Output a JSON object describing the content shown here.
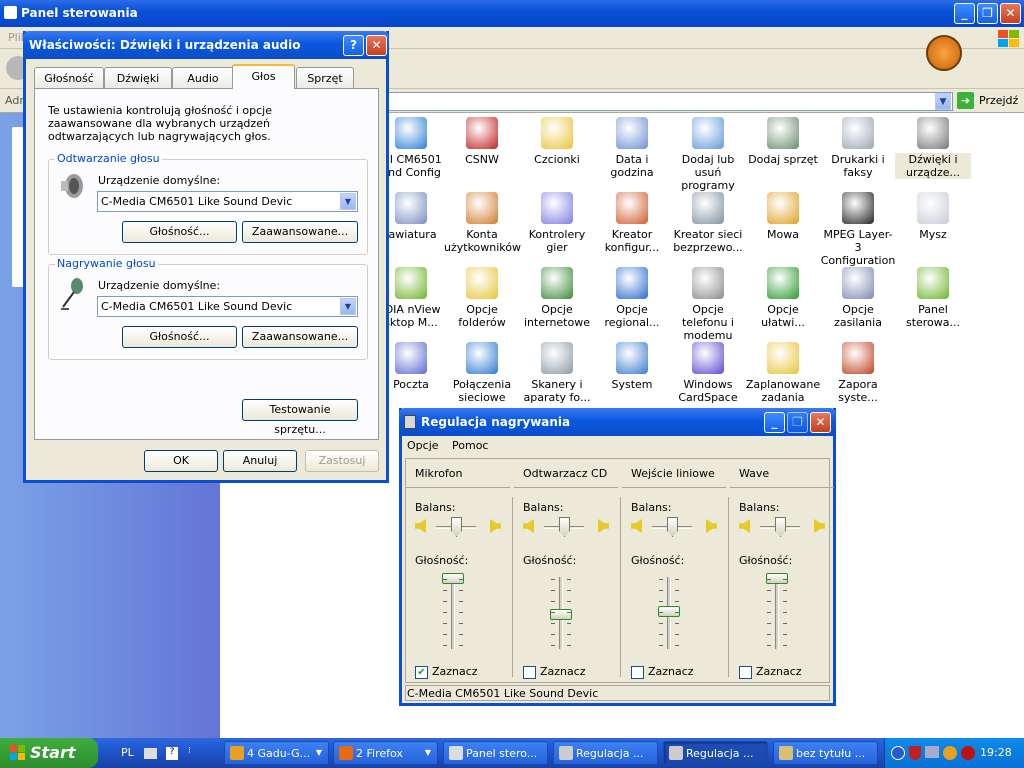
{
  "cp": {
    "title": "Panel sterowania",
    "menu_partial": "Plik",
    "addr_partial": "Adr",
    "go_label": "Przejdź"
  },
  "icons": [
    {
      "label": "MI CM6501 und Config",
      "icon": "sound-config-icon",
      "color": "#2a7fd8"
    },
    {
      "label": "CSNW",
      "icon": "network-client-icon",
      "color": "#c02020"
    },
    {
      "label": "Czcionki",
      "icon": "fonts-folder-icon",
      "color": "#e8c437"
    },
    {
      "label": "Data i godzina",
      "icon": "clock-calendar-icon",
      "color": "#6b8fd0"
    },
    {
      "label": "Dodaj lub usuń programy",
      "icon": "add-remove-programs-icon",
      "color": "#5d9ad8"
    },
    {
      "label": "Dodaj sprzęt",
      "icon": "add-hardware-icon",
      "color": "#6a8a6a"
    },
    {
      "label": "Drukarki i faksy",
      "icon": "printer-icon",
      "color": "#9aa6b2"
    },
    {
      "label": "Dźwięki i urządze...",
      "icon": "speaker-icon",
      "color": "#777",
      "selected": true
    },
    {
      "label": "lawiatura",
      "icon": "keyboard-icon",
      "color": "#7a8cc0"
    },
    {
      "label": "Konta użytkowników",
      "icon": "user-accounts-icon",
      "color": "#d07a2a"
    },
    {
      "label": "Kontrolery gier",
      "icon": "game-controller-icon",
      "color": "#7c7ce0"
    },
    {
      "label": "Kreator konfigur...",
      "icon": "network-setup-house-icon",
      "color": "#d05a2a"
    },
    {
      "label": "Kreator sieci bezprzewo...",
      "icon": "wireless-network-icon",
      "color": "#8090a0"
    },
    {
      "label": "Mowa",
      "icon": "speech-icon",
      "color": "#e0a020"
    },
    {
      "label": "MPEG Layer-3 Configuration",
      "icon": "headphones-icon",
      "color": "#222"
    },
    {
      "label": "Mysz",
      "icon": "mouse-icon",
      "color": "#c8ccd8"
    },
    {
      "label": "IDIA nView sktop M...",
      "icon": "nvidia-icon",
      "color": "#6db52a"
    },
    {
      "label": "Opcje folderów",
      "icon": "folder-options-icon",
      "color": "#e8c437"
    },
    {
      "label": "Opcje internetowe",
      "icon": "internet-options-icon",
      "color": "#3a8a3a"
    },
    {
      "label": "Opcje regional...",
      "icon": "globe-icon",
      "color": "#2a6ad0"
    },
    {
      "label": "Opcje telefonu i modemu",
      "icon": "phone-modem-icon",
      "color": "#8a8a8a"
    },
    {
      "label": "Opcje ułatwi...",
      "icon": "accessibility-icon",
      "color": "#2a9a2a"
    },
    {
      "label": "Opcje zasilania",
      "icon": "power-options-icon",
      "color": "#7a8ab0"
    },
    {
      "label": "Panel sterowa...",
      "icon": "nvidia-panel-icon",
      "color": "#6db52a"
    },
    {
      "label": "Poczta",
      "icon": "mail-icon",
      "color": "#5a6ad0"
    },
    {
      "label": "Połączenia sieciowe",
      "icon": "network-connections-icon",
      "color": "#2a7ad0"
    },
    {
      "label": "Skanery i aparaty fo...",
      "icon": "scanner-camera-icon",
      "color": "#8a9aa8"
    },
    {
      "label": "System",
      "icon": "system-icon",
      "color": "#3a7ad0"
    },
    {
      "label": "Windows CardSpace",
      "icon": "cardspace-icon",
      "color": "#5a4ad0"
    },
    {
      "label": "Zaplanowane zadania",
      "icon": "scheduled-tasks-icon",
      "color": "#e8c437"
    },
    {
      "label": "Zapora syste...",
      "icon": "firewall-icon",
      "color": "#c04020"
    }
  ],
  "dlg": {
    "title": "Właściwości: Dźwięki i urządzenia audio",
    "help": "?",
    "close": "✕",
    "tabs": [
      "Głośność",
      "Dźwięki",
      "Audio",
      "Głos",
      "Sprzęt"
    ],
    "intro": "Te ustawienia kontrolują głośność i opcje zaawansowane dla wybranych urządzeń odtwarzających lub nagrywających głos.",
    "playback": {
      "group": "Odtwarzanie głosu",
      "label": "Urządzenie domyślne:",
      "value": "C-Media CM6501 Like Sound Devic",
      "vol_btn": "Głośność...",
      "adv_btn": "Zaawansowane..."
    },
    "record": {
      "group": "Nagrywanie głosu",
      "label": "Urządzenie domyślne:",
      "value": "C-Media CM6501 Like Sound Devic",
      "vol_btn": "Głośność...",
      "adv_btn": "Zaawansowane..."
    },
    "test_btn": "Testowanie sprzętu...",
    "ok": "OK",
    "cancel": "Anuluj",
    "apply": "Zastosuj"
  },
  "rec": {
    "title": "Regulacja nagrywania",
    "menu": [
      "Opcje",
      "Pomoc"
    ],
    "balance_label": "Balans:",
    "volume_label": "Głośność:",
    "check_label": "Zaznacz",
    "status": "C-Media CM6501 Like Sound Devic",
    "channels": [
      {
        "name": "Mikrofon",
        "balance": 0.5,
        "volume": 1.0,
        "checked": true
      },
      {
        "name": "Odtwarzacz CD",
        "balance": 0.5,
        "volume": 0.45,
        "checked": false
      },
      {
        "name": "Wejście liniowe",
        "balance": 0.5,
        "volume": 0.5,
        "checked": false
      },
      {
        "name": "Wave",
        "balance": 0.5,
        "volume": 1.0,
        "checked": false
      }
    ]
  },
  "taskbar": {
    "start": "Start",
    "lang": "PL",
    "buttons": [
      {
        "label": "4 Gadu-G...",
        "icon": "gadu-icon",
        "color": "#e8a020",
        "arrow": true,
        "active": false
      },
      {
        "label": "2 Firefox",
        "icon": "firefox-icon",
        "color": "#e86a10",
        "arrow": true,
        "active": false
      },
      {
        "label": "Panel stero...",
        "icon": "control-panel-icon",
        "color": "#ddd",
        "arrow": false,
        "active": false
      },
      {
        "label": "Regulacja ...",
        "icon": "mixer-icon",
        "color": "#ccc",
        "arrow": false,
        "active": false
      },
      {
        "label": "Regulacja ...",
        "icon": "mixer-icon",
        "color": "#ccc",
        "arrow": false,
        "active": true
      },
      {
        "label": "bez tytułu ...",
        "icon": "paint-icon",
        "color": "#d8c070",
        "arrow": false,
        "active": false
      }
    ],
    "clock": "19:28"
  }
}
